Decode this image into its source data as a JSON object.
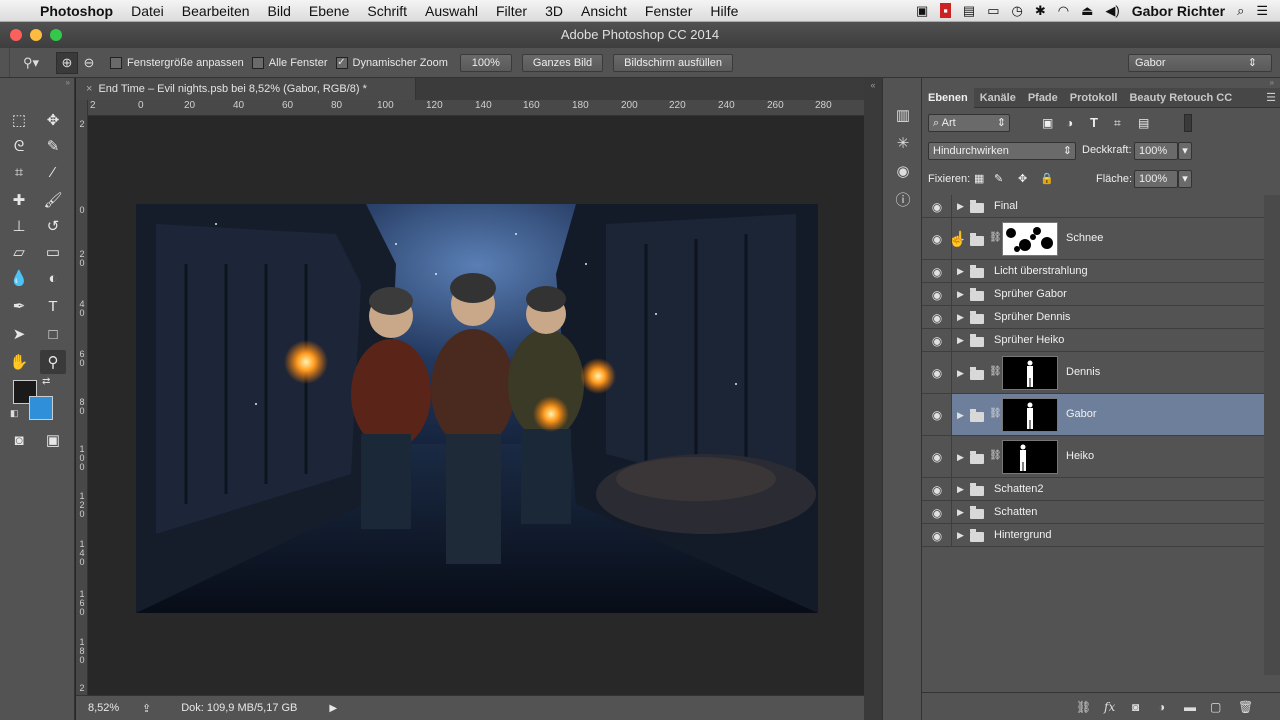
{
  "menubar": {
    "app_name": "Photoshop",
    "menus": [
      "Datei",
      "Bearbeiten",
      "Bild",
      "Ebene",
      "Schrift",
      "Auswahl",
      "Filter",
      "3D",
      "Ansicht",
      "Fenster",
      "Hilfe"
    ],
    "user": "Gabor Richter"
  },
  "window": {
    "title": "Adobe Photoshop CC 2014"
  },
  "options": {
    "chk_fit": "Fenstergröße anpassen",
    "chk_all": "Alle Fenster",
    "chk_dynamic": "Dynamischer Zoom",
    "zoom_value": "100%",
    "btn_whole": "Ganzes Bild",
    "btn_fill": "Bildschirm ausfüllen",
    "workspace": "Gabor"
  },
  "document": {
    "tab_title": "End Time – Evil nights.psb bei 8,52% (Gabor, RGB/8) *",
    "ruler_h": [
      "2",
      "0",
      "20",
      "40",
      "60",
      "80",
      "100",
      "120",
      "140",
      "160",
      "180",
      "200",
      "220",
      "240",
      "260",
      "280"
    ],
    "ruler_v": [
      "2",
      "0",
      "2 0",
      "4 0",
      "6 0",
      "8 0",
      "1 0 0",
      "1 2 0",
      "1 4 0",
      "1 6 0",
      "1 8 0",
      "2"
    ]
  },
  "status": {
    "zoom": "8,52%",
    "doc_info": "Dok: 109,9 MB/5,17 GB"
  },
  "panel": {
    "tabs": [
      "Ebenen",
      "Kanäle",
      "Pfade",
      "Protokoll",
      "Beauty Retouch CC"
    ],
    "filter_kind": "Art",
    "blend_mode": "Hindurchwirken",
    "opacity_label": "Deckkraft:",
    "opacity_value": "100%",
    "lock_label": "Fixieren:",
    "fill_label": "Fläche:",
    "fill_value": "100%",
    "layers": [
      "Final",
      "Schnee",
      "Licht überstrahlung",
      "Sprüher Gabor",
      "Sprüher Dennis",
      "Sprüher Heiko",
      "Dennis",
      "Gabor",
      "Heiko",
      "Schatten2",
      "Schatten",
      "Hintergrund"
    ],
    "selected_layer": "Gabor"
  },
  "colors": {
    "foreground": "#1a1a1a",
    "background": "#2f8fd8",
    "selection": "#6e7f9c"
  }
}
